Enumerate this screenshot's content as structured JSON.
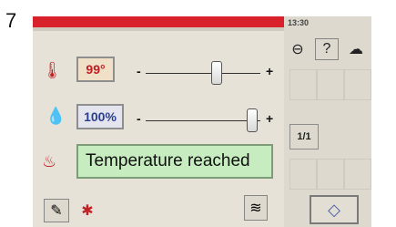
{
  "figure_label": "7",
  "clock": "13:30",
  "temperature": {
    "value": "99°",
    "slider_position": 0.62,
    "minus": "-",
    "plus": "+"
  },
  "humidity": {
    "value": "100%",
    "slider_position": 0.93,
    "minus": "-",
    "plus": "+"
  },
  "status": {
    "text": "Temperature reached"
  },
  "paging": {
    "label": "1/1"
  },
  "icons": {
    "thermometer": "thermometer-icon",
    "humidity": "drop-icon",
    "climate_mode": "climate-icon",
    "back": "back-arrow-icon",
    "help": "help-icon",
    "pastry": "pastry-icon",
    "tools": "tool-icon",
    "cleaning": "cleaning-icon",
    "tray": "tray-icon",
    "navigate": "diamond-nav-icon"
  },
  "colors": {
    "status_background": "#c6ecbf",
    "alarm_bar": "#d8212b",
    "temperature_text": "#c11c22",
    "humidity_text": "#2b3f8f"
  }
}
